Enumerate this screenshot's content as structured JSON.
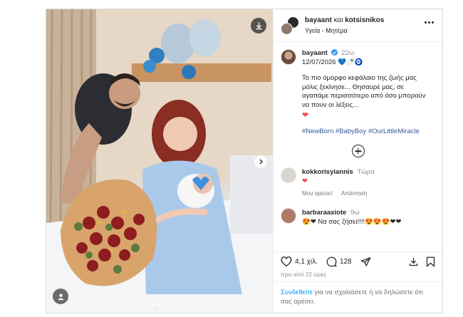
{
  "header": {
    "user1": "bayaant",
    "joiner": "και",
    "user2": "kotsisnikos",
    "location": "Υγεία - Μητέρα"
  },
  "caption": {
    "username": "bayaant",
    "time": "22ω",
    "date": "12/07/2026",
    "date_emojis": "💙🍼🧿",
    "text": "Το πιο όμορφο κεφάλαιο της ζωής μας μόλις ξεκίνησε... Θησαυρέ μας, σε αγαπάμε περισσότερο από όσο μπορούν να πουν οι λέξεις...",
    "heart": "❤",
    "hashtags": "#NewBorn #BabyBoy #OurLittleMiracle"
  },
  "comments": [
    {
      "username": "kokkorisyiannis",
      "time": "Τώρα",
      "text": "❤",
      "like_label": "Μου αρέσει!",
      "reply_label": "Απάντηση",
      "avatar_color": "#d9d4cf"
    },
    {
      "username": "barbaraaxiote",
      "time": "9ω",
      "text": "😍❤ Να σας ζήσει!!!!😍😍😍❤❤",
      "avatar_color": "#b07a6a"
    }
  ],
  "stats": {
    "likes": "4,1 χιλ.",
    "comments": "128",
    "timestamp": "πριν από 22 ώρες"
  },
  "login": {
    "link": "Συνδεθείτε",
    "text": " για να σχολιάσετε ή να δηλώσετε ότι σας αρέσει."
  },
  "icons": {
    "download": "download-icon",
    "more": "more-options-icon",
    "next": "chevron-right-icon",
    "user_tag": "user-tag-icon",
    "like": "heart-icon",
    "comment": "comment-icon",
    "share": "share-icon",
    "save": "bookmark-icon",
    "load_more": "plus-circle-icon"
  },
  "colors": {
    "link": "#0095f6",
    "hashtag": "#385898",
    "heart": "#ed4956",
    "verified": "#3897f0"
  }
}
